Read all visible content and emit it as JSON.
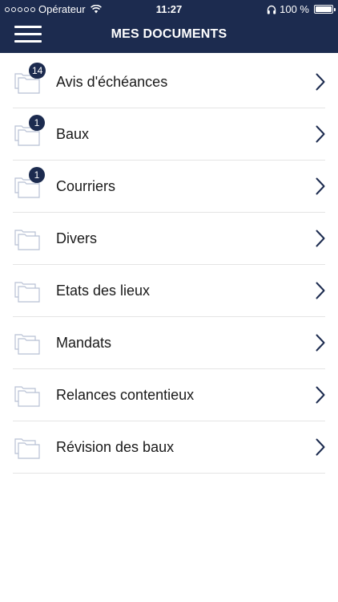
{
  "status_bar": {
    "carrier": "Opérateur",
    "time": "11:27",
    "battery": "100 %"
  },
  "header": {
    "title": "MES DOCUMENTS"
  },
  "colors": {
    "header_bg": "#1c2b4f",
    "badge_bg": "#1c2b4f",
    "folder_stroke": "#b8c0d4"
  },
  "documents": [
    {
      "label": "Avis d'échéances",
      "badge": "14"
    },
    {
      "label": "Baux",
      "badge": "1"
    },
    {
      "label": "Courriers",
      "badge": "1"
    },
    {
      "label": "Divers",
      "badge": ""
    },
    {
      "label": "Etats des lieux",
      "badge": ""
    },
    {
      "label": "Mandats",
      "badge": ""
    },
    {
      "label": "Relances contentieux",
      "badge": ""
    },
    {
      "label": "Révision des baux",
      "badge": ""
    }
  ]
}
